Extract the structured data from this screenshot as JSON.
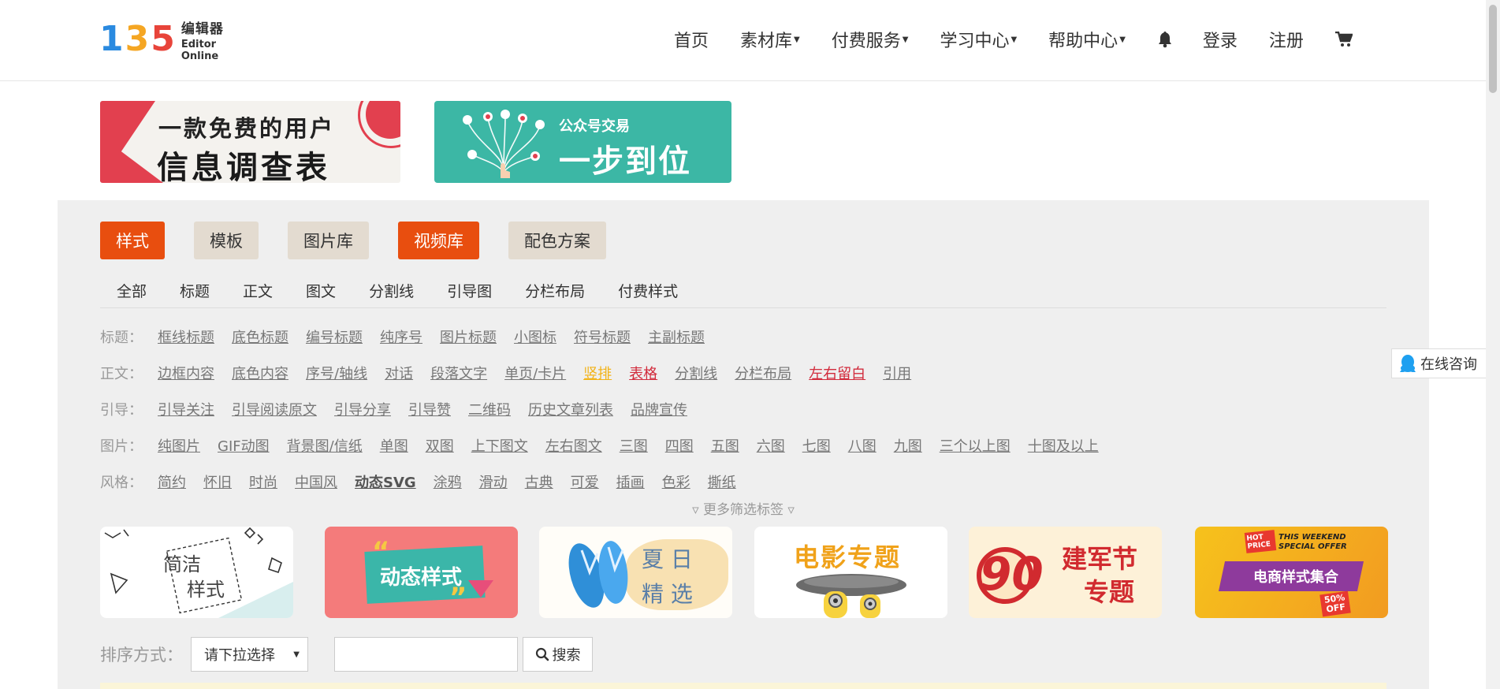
{
  "logo": {
    "cn": "编辑器",
    "en": "Editor Online",
    "digits": [
      "1",
      "3",
      "5"
    ]
  },
  "nav": {
    "home": "首页",
    "materials": "素材库",
    "paid": "付费服务",
    "learn": "学习中心",
    "help": "帮助中心",
    "login": "登录",
    "register": "注册"
  },
  "banners": {
    "survey_line1": "一款免费的用户",
    "survey_line2": "信息调查表",
    "trade_line1": "公众号交易",
    "trade_line2": "一步到位"
  },
  "category_tabs": [
    {
      "label": "样式",
      "active": true
    },
    {
      "label": "模板",
      "active": false
    },
    {
      "label": "图片库",
      "active": false
    },
    {
      "label": "视频库",
      "active": true
    },
    {
      "label": "配色方案",
      "active": false
    }
  ],
  "sub_tabs": [
    "全部",
    "标题",
    "正文",
    "图文",
    "分割线",
    "引导图",
    "分栏布局",
    "付费样式"
  ],
  "filters": [
    {
      "label": "标题：",
      "items": [
        "框线标题",
        "底色标题",
        "编号标题",
        "纯序号",
        "图片标题",
        "小图标",
        "符号标题",
        "主副标题"
      ]
    },
    {
      "label": "正文：",
      "items": [
        "边框内容",
        "底色内容",
        "序号/轴线",
        "对话",
        "段落文字",
        "单页/卡片",
        "竖排",
        "表格",
        "分割线",
        "分栏布局",
        "左右留白",
        "引用"
      ]
    },
    {
      "label": "引导：",
      "items": [
        "引导关注",
        "引导阅读原文",
        "引导分享",
        "引导赞",
        "二维码",
        "历史文章列表",
        "品牌宣传"
      ]
    },
    {
      "label": "图片：",
      "items": [
        "纯图片",
        "GIF动图",
        "背景图/信纸",
        "单图",
        "双图",
        "上下图文",
        "左右图文",
        "三图",
        "四图",
        "五图",
        "六图",
        "七图",
        "八图",
        "九图",
        "三个以上图",
        "十图及以上"
      ]
    },
    {
      "label": "风格：",
      "items": [
        "简约",
        "怀旧",
        "时尚",
        "中国风",
        "动态SVG",
        "涂鸦",
        "滑动",
        "古典",
        "可爱",
        "插画",
        "色彩",
        "撕纸"
      ]
    }
  ],
  "more_filters": "▿ 更多筛选标签 ▿",
  "cards": {
    "simple_l1": "简洁",
    "simple_l2": "样式",
    "dynamic": "动态样式",
    "summer_l1": "夏 日",
    "summer_l2": "精 选",
    "movie": "电影专题",
    "army_l1": "建军节",
    "army_l2": "专题",
    "army_num": "90",
    "shop_hot": "HOT PRICE",
    "shop_weekend": "THIS WEEKEND SPECIAL OFFER",
    "shop_main": "电商样式集合",
    "shop_off": "50% OFF"
  },
  "sort": {
    "label": "排序方式：",
    "select_value": "请下拉选择",
    "search_value": "",
    "search_button": "搜索"
  },
  "consult": "在线咨询",
  "colors": {
    "accent": "#e84e0f",
    "tab_inactive": "#e3dbd0",
    "panel_bg": "#efefef",
    "teal": "#3cb7a5",
    "red": "#e2404f"
  }
}
